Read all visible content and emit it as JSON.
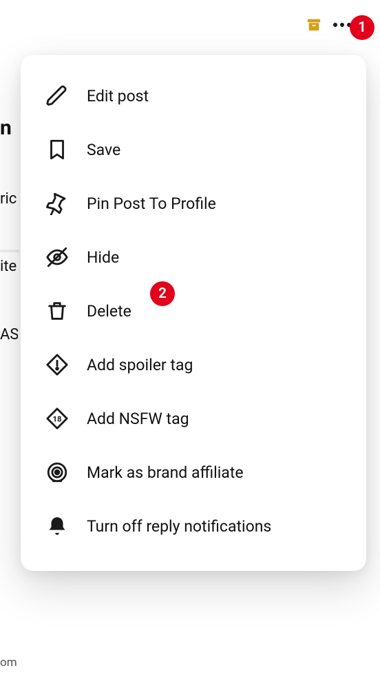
{
  "toolbar": {
    "archive_icon": "archive-icon",
    "more_icon": "more-icon"
  },
  "annotations": {
    "badge1": "1",
    "badge2": "2"
  },
  "partial": {
    "line1": "n",
    "line2": "ric",
    "line3": "ite",
    "line4": "AS",
    "com": "om"
  },
  "menu": {
    "items": [
      {
        "label": "Edit post"
      },
      {
        "label": "Save"
      },
      {
        "label": "Pin Post To Profile"
      },
      {
        "label": "Hide"
      },
      {
        "label": "Delete"
      },
      {
        "label": "Add spoiler tag"
      },
      {
        "label": "Add NSFW tag"
      },
      {
        "label": "Mark as brand affiliate"
      },
      {
        "label": "Turn off reply notifications"
      }
    ]
  }
}
